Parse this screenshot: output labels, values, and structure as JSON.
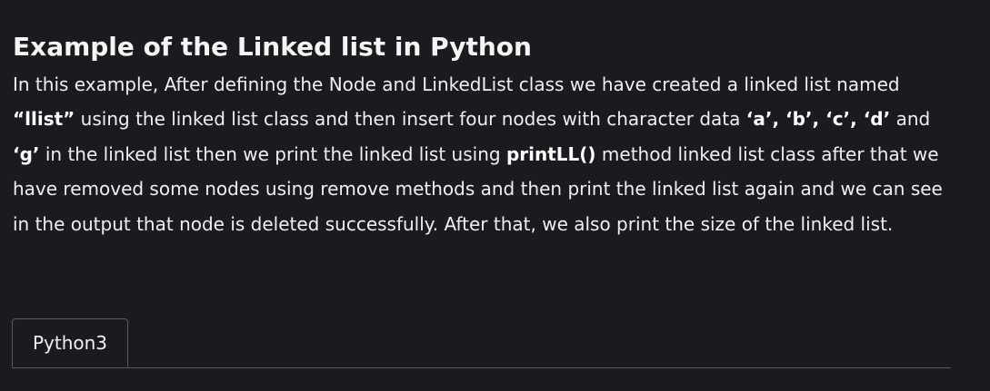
{
  "article": {
    "title": "Example of the Linked list in Python",
    "paragraph": [
      {
        "text": "In this example, After defining the Node and LinkedList class we have created a linked list named ",
        "bold": false
      },
      {
        "text": "“llist”",
        "bold": true
      },
      {
        "text": " using the linked list class and then insert four nodes with character data ",
        "bold": false
      },
      {
        "text": "‘a’, ‘b’, ‘c’, ‘d’",
        "bold": true
      },
      {
        "text": " and ",
        "bold": false
      },
      {
        "text": "‘g’",
        "bold": true
      },
      {
        "text": " in the linked list then we print the linked list using ",
        "bold": false
      },
      {
        "text": "printLL()",
        "bold": true
      },
      {
        "text": " method linked list class after that we have removed some nodes using remove methods and then print the linked list again and we can see in the output that node is deleted successfully. After that, we also print the size of the linked list.",
        "bold": false
      }
    ]
  },
  "code_block": {
    "tabs": [
      {
        "label": "Python3",
        "active": true
      }
    ]
  },
  "colors": {
    "background": "#1a1b1e",
    "text": "#f0f0f0",
    "border": "#5a5b5e"
  }
}
